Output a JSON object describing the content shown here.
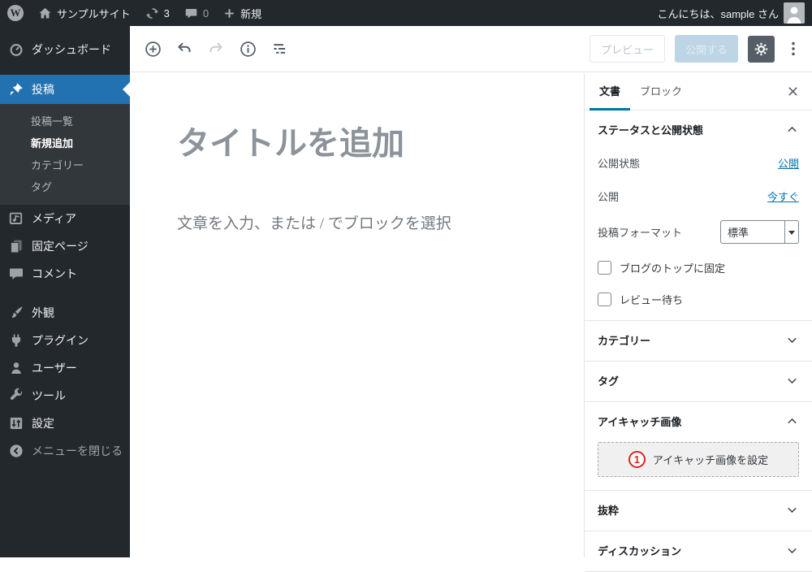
{
  "admin_bar": {
    "wp_logo_glyph": "W",
    "site_name": "サンプルサイト",
    "update_count": "3",
    "comment_count": "0",
    "new_label": "新規",
    "greeting": "こんにちは、sample さん"
  },
  "sidebar": {
    "items": [
      {
        "label": "ダッシュボード",
        "icon": "dashboard-icon"
      },
      {
        "label": "投稿",
        "icon": "pin-icon",
        "active": true
      },
      {
        "label": "メディア",
        "icon": "media-icon"
      },
      {
        "label": "固定ページ",
        "icon": "pages-icon"
      },
      {
        "label": "コメント",
        "icon": "comment-icon"
      },
      {
        "label": "外観",
        "icon": "brush-icon"
      },
      {
        "label": "プラグイン",
        "icon": "plugin-icon"
      },
      {
        "label": "ユーザー",
        "icon": "user-icon"
      },
      {
        "label": "ツール",
        "icon": "wrench-icon"
      },
      {
        "label": "設定",
        "icon": "sliders-icon"
      },
      {
        "label": "メニューを閉じる",
        "icon": "collapse-icon"
      }
    ],
    "post_submenu": [
      {
        "label": "投稿一覧"
      },
      {
        "label": "新規追加",
        "current": true
      },
      {
        "label": "カテゴリー"
      },
      {
        "label": "タグ"
      }
    ]
  },
  "editor_header": {
    "preview_label": "プレビュー",
    "publish_label": "公開する"
  },
  "canvas": {
    "title_placeholder": "タイトルを追加",
    "body_placeholder": "文章を入力、または / でブロックを選択"
  },
  "settings_panel": {
    "tabs": [
      {
        "label": "文書",
        "active": true
      },
      {
        "label": "ブロック",
        "active": false
      }
    ],
    "status": {
      "title": "ステータスと公開状態",
      "visibility_label": "公開状態",
      "visibility_value": "公開",
      "publish_label": "公開",
      "publish_value": "今すぐ",
      "format_label": "投稿フォーマット",
      "format_value": "標準",
      "sticky_label": "ブログのトップに固定",
      "pending_label": "レビュー待ち"
    },
    "categories_title": "カテゴリー",
    "tags_title": "タグ",
    "featured": {
      "title": "アイキャッチ画像",
      "badge": "1",
      "button_label": "アイキャッチ画像を設定"
    },
    "excerpt_title": "抜粋",
    "discussion_title": "ディスカッション"
  },
  "colors": {
    "admin_dark": "#23282d",
    "submenu_dark": "#32373c",
    "menu_active_blue": "#2271b1",
    "link_blue": "#0073aa",
    "tab_accent": "#0073aa",
    "border_gray": "#e2e4e7",
    "annotation_red": "#e02121",
    "publish_disabled_bg": "#bdd5e4"
  }
}
